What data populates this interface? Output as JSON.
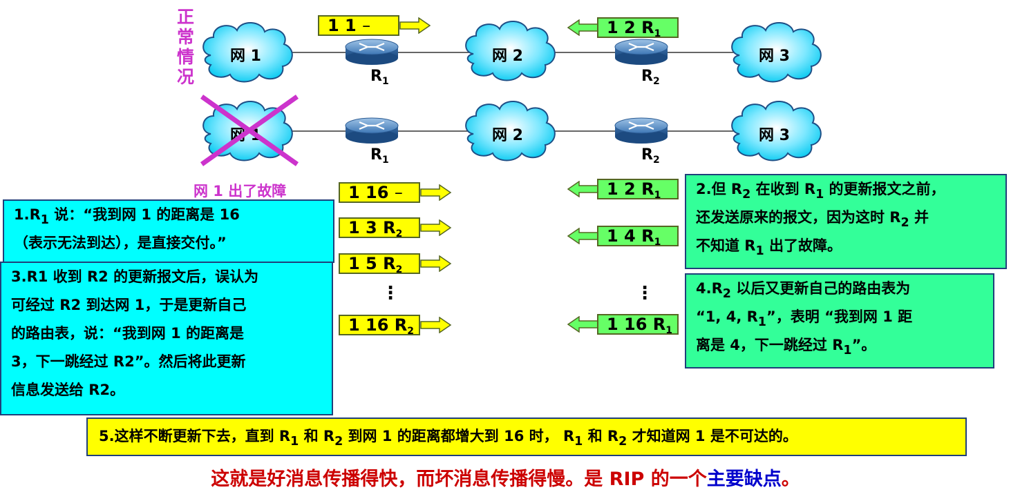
{
  "side_label": [
    "正",
    "常",
    "情",
    "况"
  ],
  "clouds": {
    "net1": "网 1",
    "net2": "网 2",
    "net3": "网 3"
  },
  "routers": {
    "r1": "R",
    "r1_sub": "1",
    "r2": "R",
    "r2_sub": "2"
  },
  "fault_label": "网 1 出了故障",
  "normal_tables": {
    "r1": {
      "text": "1  1  ",
      "dash": "–"
    },
    "r2": {
      "text": "1  2  R",
      "sub": "1"
    }
  },
  "r1_tables": [
    {
      "text": "1  16  ",
      "dash": "–"
    },
    {
      "text": "1  3  R",
      "sub": "2"
    },
    {
      "text": "1  5  R",
      "sub": "2"
    },
    {
      "text": "1  16  R",
      "sub": "2"
    }
  ],
  "r2_tables": [
    {
      "text": "1  2  R",
      "sub": "1"
    },
    {
      "text": "1  4  R",
      "sub": "1"
    },
    {
      "text": "1  16  R",
      "sub": "1"
    }
  ],
  "ellipsis": "⋮",
  "notes": {
    "n1": {
      "l1_a": "1.R",
      "l1_sub": "1",
      "l1_b": " 说：“我到网 1 的距离是 16",
      "l2": "（表示无法到达），是直接交付。”"
    },
    "n2": {
      "l1_a": "2.但 R",
      "l1_sub1": "2",
      "l1_b": " 在收到 R",
      "l1_sub2": "1",
      "l1_c": " 的更新报文之前，",
      "l2_a": "还发送原来的报文，因为这时 R",
      "l2_sub": "2",
      "l2_b": " 并",
      "l3_a": "不知道 R",
      "l3_sub": "1",
      "l3_b": " 出了故障。"
    },
    "n3": {
      "l1": "3.R1 收到 R2 的更新报文后，误认为",
      "l2": "可经过 R2 到达网 1，于是更新自己",
      "l3": "的路由表，说：“我到网 1 的距离是",
      "l4": "3，下一跳经过 R2”。然后将此更新",
      "l5": "信息发送给 R2。"
    },
    "n4": {
      "l1_a": "4.R",
      "l1_sub": "2",
      "l1_b": " 以后又更新自己的路由表为",
      "l2_a": "“1, 4, R",
      "l2_sub": "1",
      "l2_b": "”，表明 “我到网 1 距",
      "l3_a": "离是 4，下一跳经过 R",
      "l3_sub": "1",
      "l3_b": "”。"
    },
    "n5": {
      "a": "5.这样不断更新下去，直到 R",
      "s1": "1",
      "b": " 和 R",
      "s2": "2",
      "c": " 到网 1 的距离都增大到 16 时， R",
      "s3": "1",
      "d": " 和 R",
      "s4": "2",
      "e": " 才知道网 1 是不可达的。"
    }
  },
  "conclusion": {
    "red": "这就是好消息传播得快，而坏消息传播得慢。是 RIP 的一个",
    "blue": "主要缺点",
    "end": "。"
  },
  "colors": {
    "magenta": "#cc33cc",
    "cyan": "#00ffff",
    "green": "#33ff99",
    "yellow": "#ffff00",
    "red": "#cc0000",
    "blue": "#0000cc"
  }
}
